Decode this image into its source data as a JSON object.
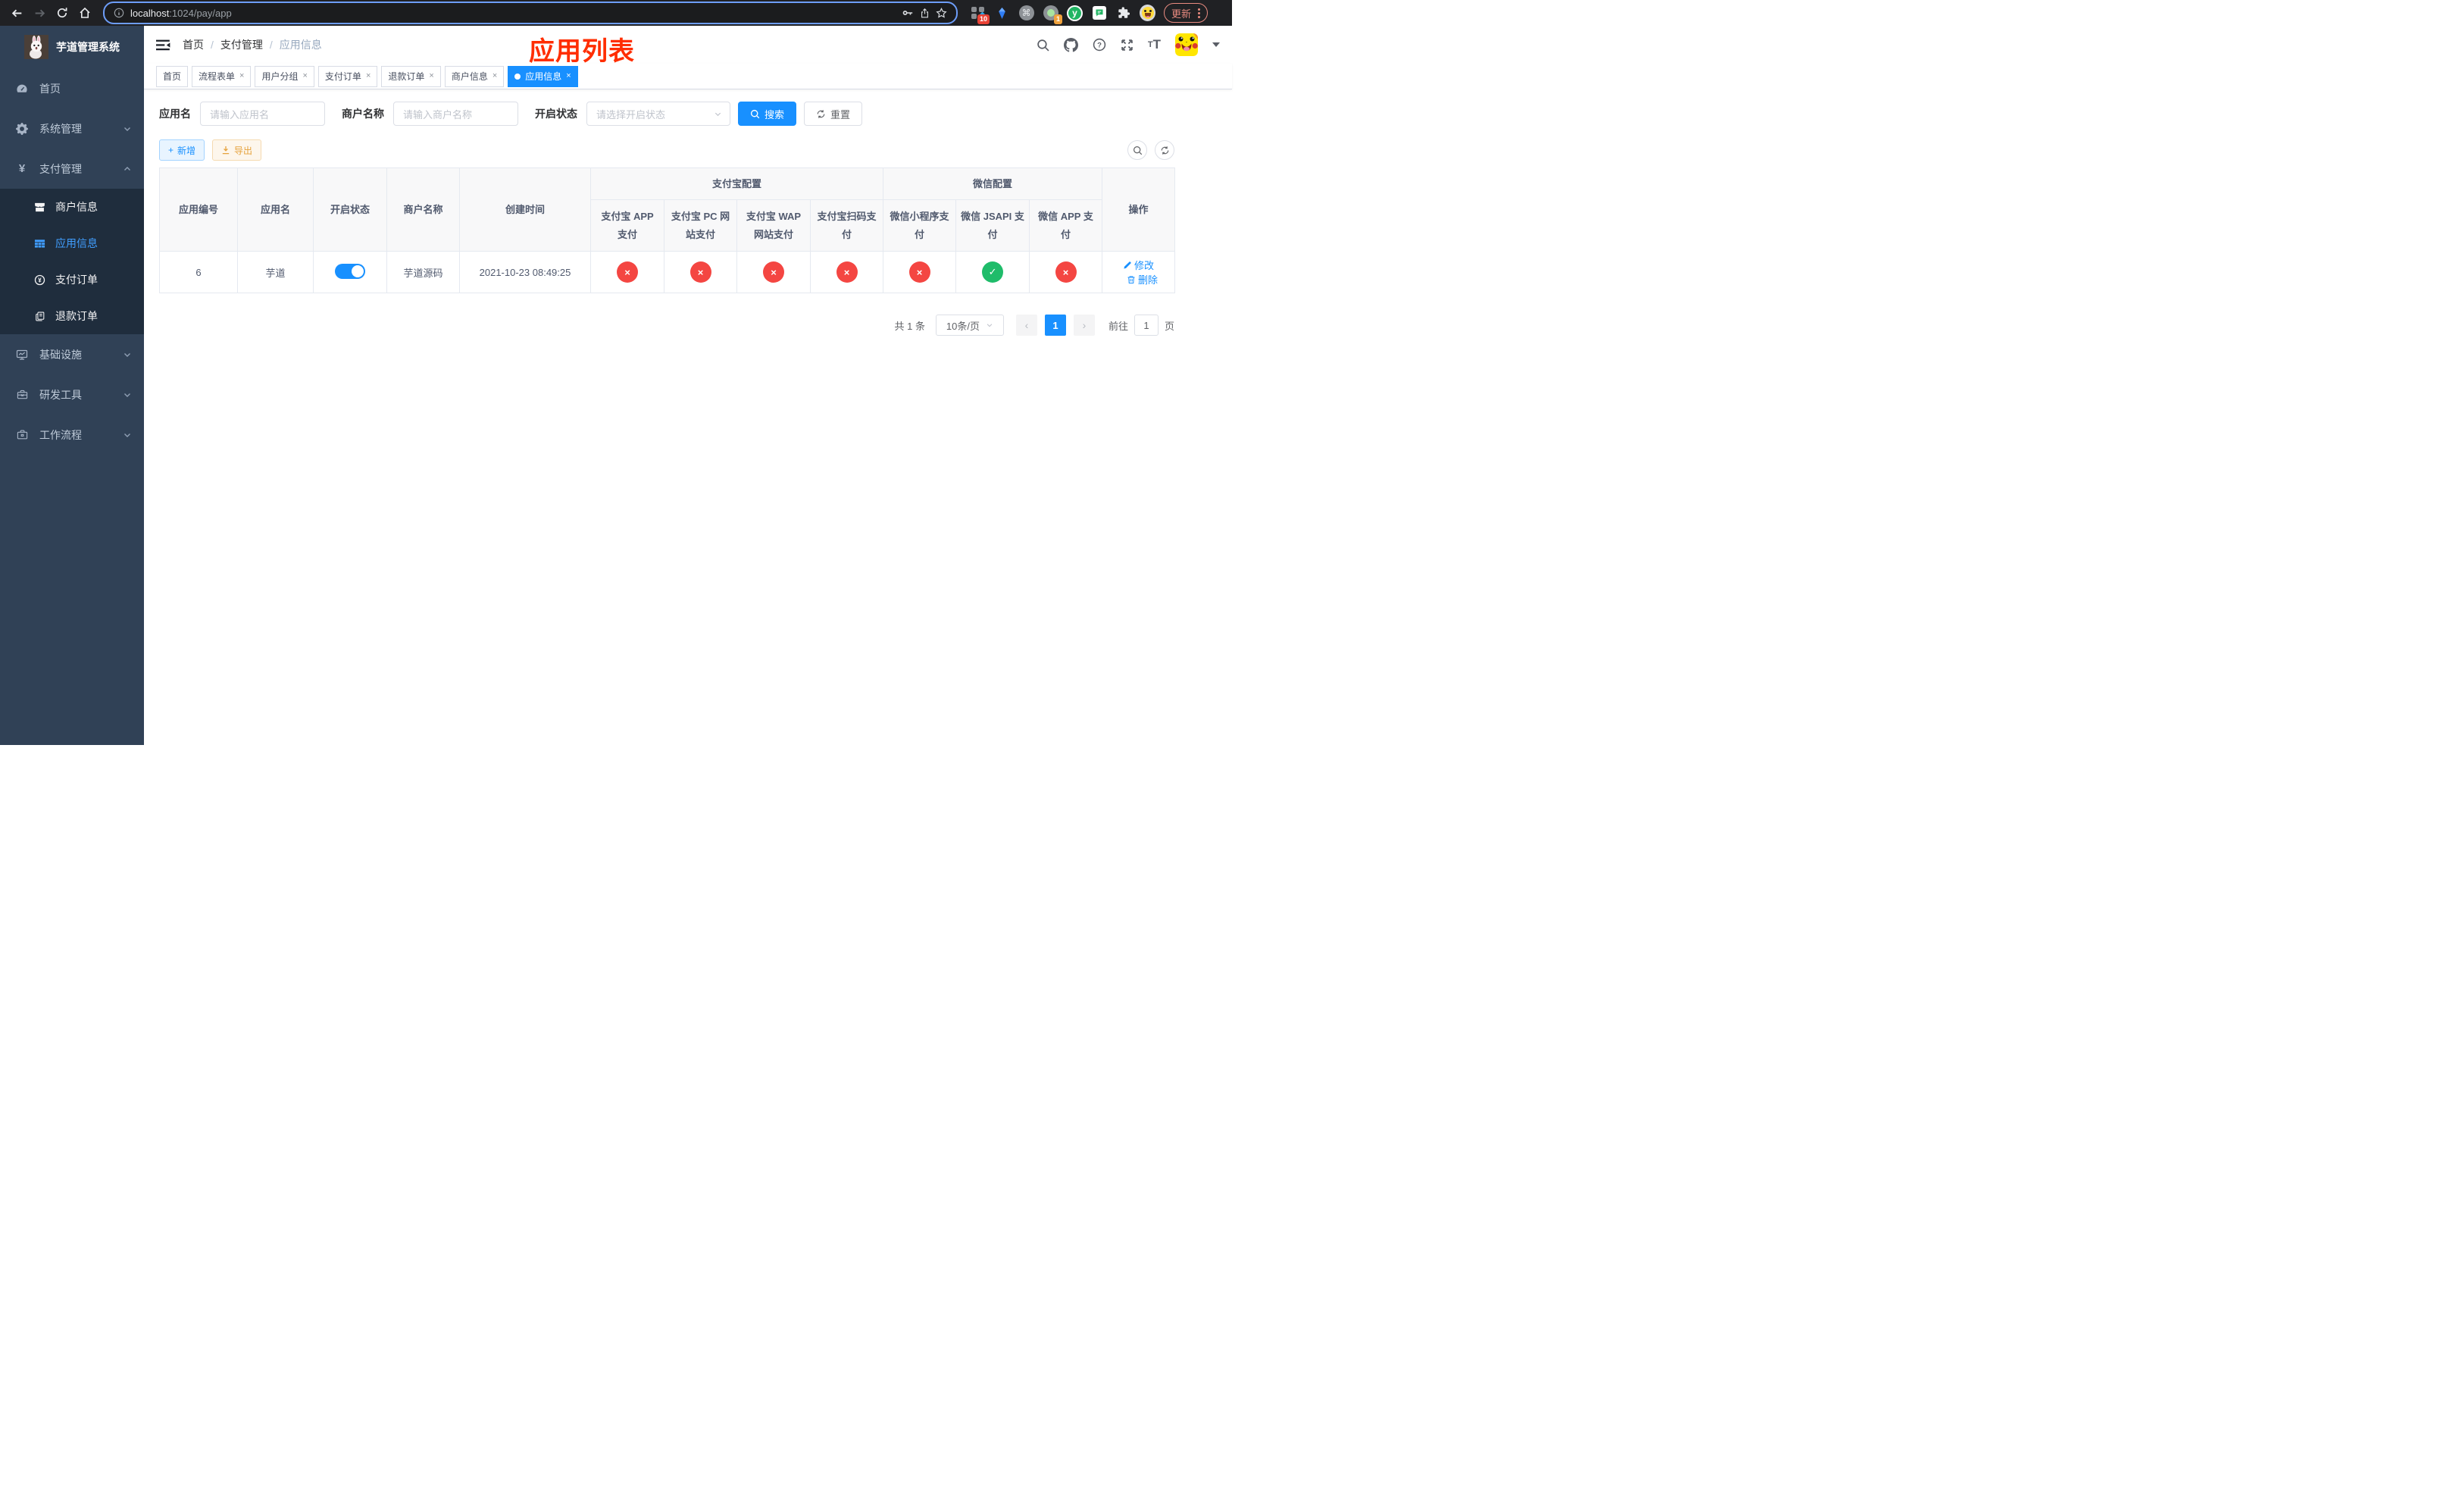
{
  "colors": {
    "accent": "#1890ff",
    "sidebar_bg": "#304156",
    "submenu_bg": "#1f2d3d",
    "active_menu": "#409eff",
    "danger": "#f44642",
    "success": "#1fbc6a",
    "warning": "#e6a23c",
    "annotation_red": "#ff2d00"
  },
  "browser": {
    "url_host": "localhost",
    "url_rest": ":1024/pay/app",
    "ext_badge_10": "10",
    "ext_badge_1": "1",
    "ext_cmd_glyph": "⌘",
    "ext_y_glyph": "y",
    "update_label": "更新"
  },
  "sidebar": {
    "title": "芋道管理系统",
    "items": [
      {
        "label": "首页",
        "icon": "dashboard-icon",
        "expandable": false
      },
      {
        "label": "系统管理",
        "icon": "gear-icon",
        "expandable": true,
        "expanded": false
      },
      {
        "label": "支付管理",
        "icon": "yen-icon",
        "expandable": true,
        "expanded": true
      },
      {
        "label": "基础设施",
        "icon": "monitor-icon",
        "expandable": true,
        "expanded": false
      },
      {
        "label": "研发工具",
        "icon": "toolbox-icon",
        "expandable": true,
        "expanded": false
      },
      {
        "label": "工作流程",
        "icon": "briefcase-icon",
        "expandable": true,
        "expanded": false
      }
    ],
    "submenu": [
      {
        "label": "商户信息",
        "icon": "shop-icon",
        "active": false
      },
      {
        "label": "应用信息",
        "icon": "table-grid-icon",
        "active": true
      },
      {
        "label": "支付订单",
        "icon": "pay-order-icon",
        "active": false
      },
      {
        "label": "退款订单",
        "icon": "refund-icon",
        "active": false
      }
    ]
  },
  "header": {
    "breadcrumb": [
      "首页",
      "支付管理",
      "应用信息"
    ],
    "annotation": "应用列表"
  },
  "tabs": [
    {
      "label": "首页",
      "closable": false,
      "active": false
    },
    {
      "label": "流程表单",
      "closable": true,
      "active": false
    },
    {
      "label": "用户分组",
      "closable": true,
      "active": false
    },
    {
      "label": "支付订单",
      "closable": true,
      "active": false
    },
    {
      "label": "退款订单",
      "closable": true,
      "active": false
    },
    {
      "label": "商户信息",
      "closable": true,
      "active": false
    },
    {
      "label": "应用信息",
      "closable": true,
      "active": true
    }
  ],
  "filters": {
    "app_name_label": "应用名",
    "app_name_placeholder": "请输入应用名",
    "merchant_label": "商户名称",
    "merchant_placeholder": "请输入商户名称",
    "status_label": "开启状态",
    "status_placeholder": "请选择开启状态",
    "search_label": "搜索",
    "reset_label": "重置"
  },
  "toolbar": {
    "add_label": "新增",
    "export_label": "导出"
  },
  "table": {
    "headers": [
      "应用编号",
      "应用名",
      "开启状态",
      "商户名称",
      "创建时间",
      "操作"
    ],
    "group_headers": [
      "支付宝配置",
      "微信配置"
    ],
    "sub_headers": [
      "支付宝 APP 支付",
      "支付宝 PC 网站支付",
      "支付宝 WAP 网站支付",
      "支付宝扫码支付",
      "微信小程序支付",
      "微信 JSAPI 支付",
      "微信 APP 支付"
    ],
    "row": {
      "id": "6",
      "name": "芋道",
      "enabled": true,
      "merchant": "芋道源码",
      "created_at": "2021-10-23 08:49:25",
      "statuses": [
        false,
        false,
        false,
        false,
        false,
        true,
        false
      ],
      "edit_label": "修改",
      "delete_label": "删除"
    }
  },
  "pagination": {
    "total_text": "共 1 条",
    "page_size": "10条/页",
    "prev_glyph": "‹",
    "next_glyph": "›",
    "current_page": "1",
    "goto_prefix": "前往",
    "goto_value": "1",
    "goto_suffix": "页"
  }
}
